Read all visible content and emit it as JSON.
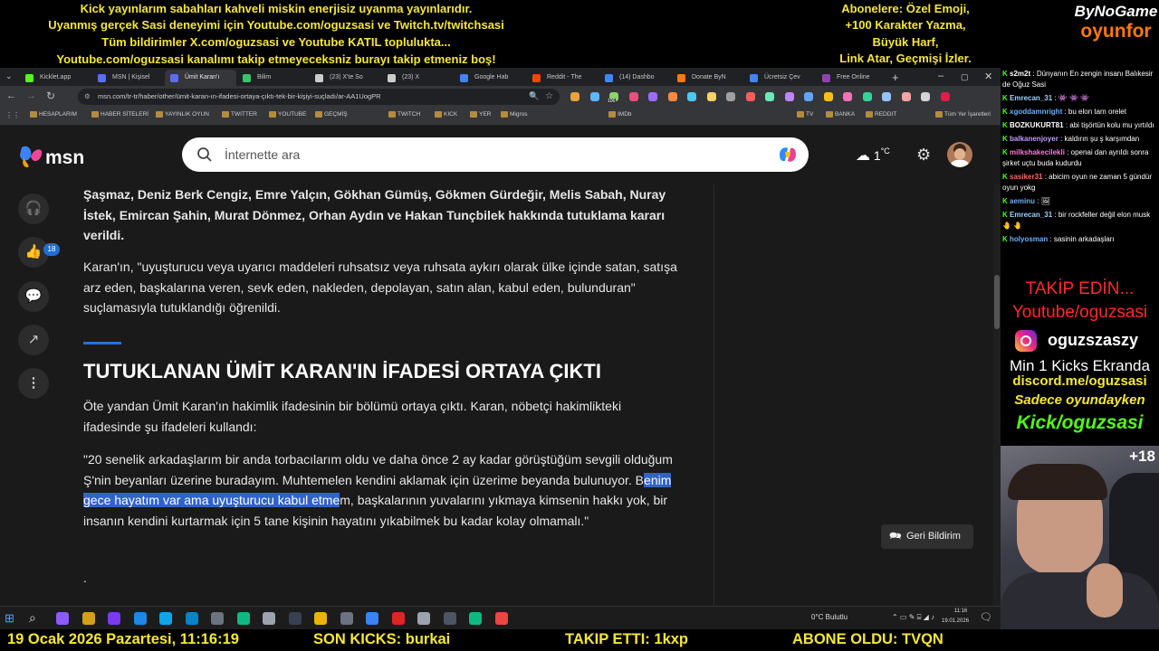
{
  "overlay": {
    "top_lines": [
      "Kick yayınlarım sabahları kahveli miskin enerjisiz uyanma yayınlarıdır.",
      "Uyanmış gerçek Sasi deneyimi için Youtube.com/oguzsasi ve Twitch.tv/twitchsasi",
      "Tüm bildirimler X.com/oguzsasi ve Youtube KATIL toplulukta...",
      "Youtube.com/oguzsasi kanalımı takip etmeyeceksniz burayı takip etmeniz boş!"
    ],
    "sub_lines": [
      "Abonelere: Özel Emoji,",
      "+100 Karakter Yazma,",
      "Büyük Harf,",
      "Link Atar, Geçmişi İzler."
    ],
    "logo_top": "ByNoGame",
    "logo_bottom": "oyunfor"
  },
  "browser": {
    "tabs": [
      {
        "label": "Kicklet.app",
        "color": "#53fc18"
      },
      {
        "label": "MSN | Kişisel",
        "color": "#5b6cff"
      },
      {
        "label": "Ümit Karan'ı",
        "color": "#5b6cff",
        "active": true
      },
      {
        "label": "Bilim",
        "color": "#35c46a"
      },
      {
        "label": "(23) X'te So",
        "color": "#cccccc"
      },
      {
        "label": "(23) X",
        "color": "#cccccc"
      },
      {
        "label": "Google Hab",
        "color": "#4285f4"
      },
      {
        "label": "Reddit - The",
        "color": "#ff4500"
      },
      {
        "label": "(14) Dashbo",
        "color": "#4285f4"
      },
      {
        "label": "Donate ByN",
        "color": "#ff7a00"
      },
      {
        "label": "Ücretsiz Çev",
        "color": "#4285f4"
      },
      {
        "label": "Free Online",
        "color": "#8e44ad"
      }
    ],
    "url": "msn.com/tr-tr/haber/other/ümit-karan-ın-ifadesi-ortaya-çıktı-tek-bir-kişiyi-suçladı/ar-AA1UogPR",
    "bookmarks": [
      "HESAPLARIM",
      "HABER SİTELERİ",
      "YAYINLIK OYUN",
      "TWITTER",
      "YOUTUBE",
      "GEÇMİŞ",
      "TWITCH",
      "KICK",
      "YER",
      "Migros",
      "IMDb",
      "TV",
      "BANKA",
      "REDDIT",
      "Tüm Yer İşaretleri"
    ],
    "ext_badge": "106"
  },
  "msn": {
    "logo": "msn",
    "search_placeholder": "İnternette ara",
    "temperature": "1",
    "temperature_unit": "°C",
    "like_count": "18",
    "feedback_label": "Geri Bildirim"
  },
  "article": {
    "p1": "Şaşmaz, Deniz Berk Cengiz, Emre Yalçın, Gökhan Gümüş, Gökmen Gürdeğir, Melis Sabah, Nuray İstek, Emircan Şahin, Murat Dönmez, Orhan Aydın ve Hakan Tunçbilek hakkında tutuklama kararı verildi.",
    "p2": "Karan'ın, \"uyuşturucu veya uyarıcı maddeleri ruhsatsız veya ruhsata aykırı olarak ülke içinde satan, satışa arz eden, başkalarına veren, sevk eden, nakleden, depolayan, satın alan, kabul eden, bulunduran\" suçlamasıyla tutuklandığı öğrenildi.",
    "heading": "TUTUKLANAN ÜMİT KARAN'IN İFADESİ ORTAYA ÇIKTI",
    "p3": "Öte yandan Ümit Karan'ın hakimlik ifadesinin bir bölümü ortaya çıktı. Karan, nöbetçi hakimlikteki ifadesinde şu ifadeleri kullandı:",
    "p4_before": "\"20 senelik arkadaşlarım bir anda torbacılarım oldu ve daha önce 2 ay kadar görüştüğüm sevgili olduğum Ş'nin beyanları üzerine buradayım. Muhtemelen kendini aklamak için üzerime beyanda bulunuyor. B",
    "p4_highlight": "enim gece hayatım var ama uyuşturucu kabul etme",
    "p4_after": "m, başkalarının yuvalarını yıkmaya kimsenin hakkı yok, bir insanın kendini kurtarmak için 5 tane kişinin hayatını yıkabilmek bu kadar kolay olmamalı.\"",
    "dot": "."
  },
  "taskbar": {
    "weather": "0°C  Bulutlu",
    "time": "11:16",
    "date": "19.01.2026"
  },
  "ticker": {
    "datetime": "19 Ocak 2026 Pazartesi, 11:16:19",
    "kicks": "SON KICKS: burkai",
    "follow": "TAKIP ETTI: 1kxp",
    "sub": "ABONE OLDU: TVQN"
  },
  "chat": {
    "messages": [
      {
        "user": "s2m2t",
        "text": ": Dünyanın En zengin insanı Balıkesir de Oğuz Sasi",
        "color": "#ffffff"
      },
      {
        "user": "Emrecan_31",
        "text": ": 👾 👾 👾",
        "color": "#9ad0ff"
      },
      {
        "user": "xgoddamnright",
        "text": ": bu elon tam orelet",
        "color": "#6ab0ff"
      },
      {
        "user": "BOZKUKURT81",
        "text": ": abi tişörtün kolu mu yırtıldı",
        "color": "#ffffff"
      },
      {
        "user": "balkanenjoyer",
        "text": ": kaldırın şu ş karşımdan",
        "color": "#c49bff"
      },
      {
        "user": "milkshakecilekli",
        "text": ": openai dan ayrıldı sonra şirket uçtu buda kudurdu",
        "color": "#ff7ad9"
      },
      {
        "user": "sasiker31",
        "text": ": abicim oyun ne zaman 5 gündür oyun yokg",
        "color": "#ff6b6b"
      },
      {
        "user": "aeminu",
        "text": ": 🖼",
        "color": "#6ab0ff"
      },
      {
        "user": "Emrecan_31",
        "text": ": bir rockfeller değil elon musk 🤚 🤚",
        "color": "#9ad0ff"
      },
      {
        "user": "holyosman",
        "text": ": sasinin arkadaşları",
        "color": "#6ab0ff"
      }
    ],
    "kick_mark": "K"
  },
  "promo": {
    "takip": "TAKİP EDİN...",
    "youtube": "Youtube/oguzsasi",
    "instagram": "oguzszaszy",
    "min_kicks": "Min 1 Kicks Ekranda",
    "discord": "discord.me/oguzsasi",
    "sadece": "Sadece oyundayken",
    "kick": "Kick/oguzsasi",
    "age": "+18"
  },
  "colors": {
    "overlay_yellow": "#f5e63a",
    "kick_green": "#53fc18",
    "promo_red": "#ff2a2a",
    "highlight": "#2f63c8",
    "msn_accent": "#2a6fd6"
  }
}
